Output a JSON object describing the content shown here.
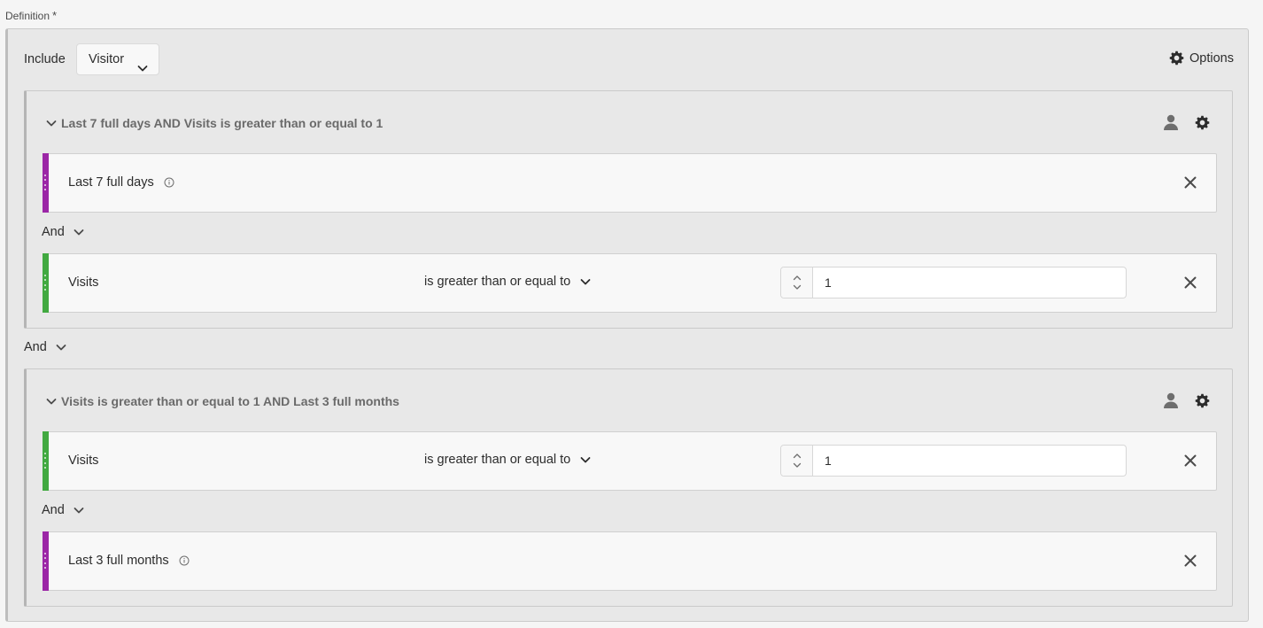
{
  "definition": {
    "label": "Definition",
    "required_mark": "*"
  },
  "header": {
    "include_label": "Include",
    "context_value": "Visitor",
    "options_label": "Options"
  },
  "containers": [
    {
      "title": "Last 7 full days AND Visits is greater than or equal to 1",
      "rows": [
        {
          "type": "date-range",
          "color": "#9b26a6",
          "name": "Last 7 full days"
        },
        {
          "type": "metric",
          "color": "#41a940",
          "name": "Visits",
          "operator": "is greater than or equal to",
          "value": "1"
        }
      ],
      "inner_and": "And"
    },
    {
      "title": "Visits is greater than or equal to 1 AND Last 3 full months",
      "rows": [
        {
          "type": "metric",
          "color": "#41a940",
          "name": "Visits",
          "operator": "is greater than or equal to",
          "value": "1"
        },
        {
          "type": "date-range",
          "color": "#9b26a6",
          "name": "Last 3 full months"
        }
      ],
      "inner_and": "And"
    }
  ],
  "outer_and": "And",
  "icons": {
    "gear": "gear-icon",
    "user": "user-icon",
    "close": "close-icon",
    "info": "info-icon",
    "chevron": "chevron-down-icon"
  }
}
